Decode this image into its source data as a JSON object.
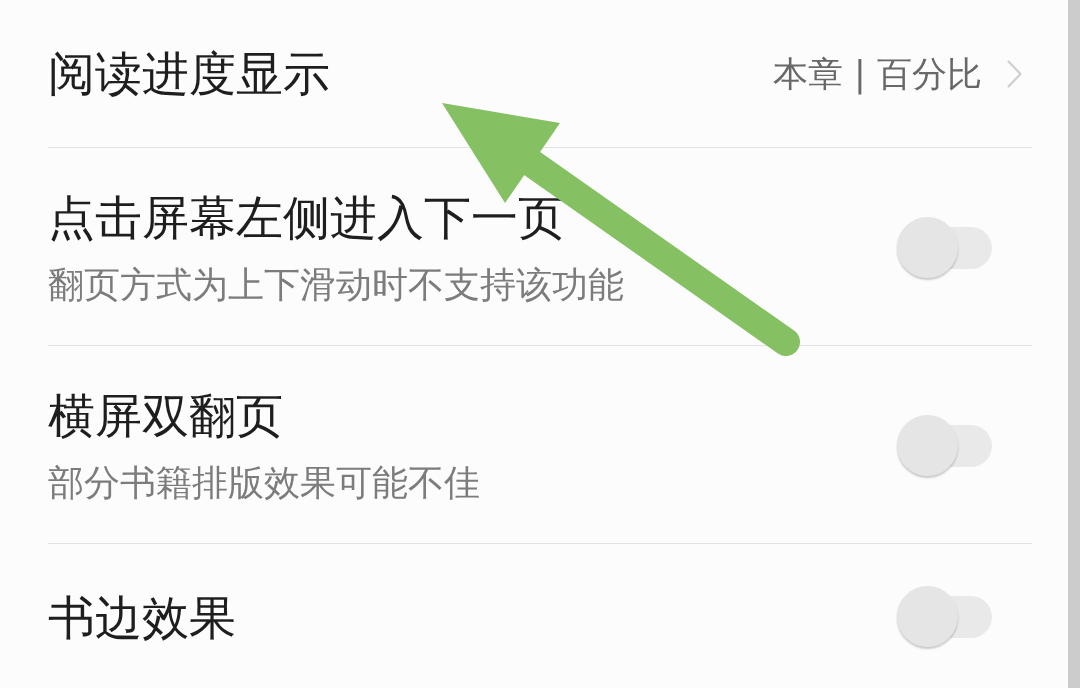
{
  "settings": [
    {
      "kind": "value",
      "title": "阅读进度显示",
      "value": "本章 | 百分比"
    },
    {
      "kind": "toggle",
      "title": "点击屏幕左侧进入下一页",
      "subtitle": "翻页方式为上下滑动时不支持该功能",
      "on": false
    },
    {
      "kind": "toggle",
      "title": "横屏双翻页",
      "subtitle": "部分书籍排版效果可能不佳",
      "on": false
    },
    {
      "kind": "toggle",
      "title": "书边效果",
      "on": false
    }
  ],
  "annotations": [
    {
      "kind": "arrow"
    }
  ]
}
